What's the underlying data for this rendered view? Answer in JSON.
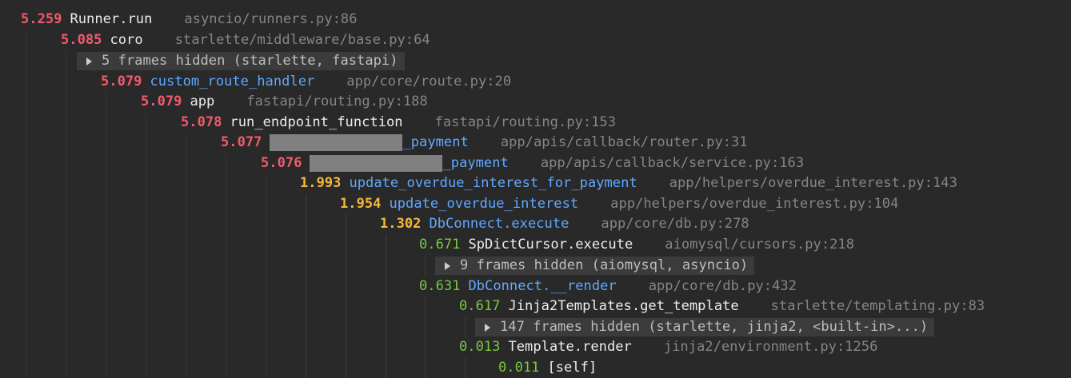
{
  "frames": [
    {
      "time": "5.259",
      "fn": "Runner.run",
      "loc": "asyncio/runners.py:86"
    },
    {
      "time": "5.085",
      "fn": "coro",
      "loc": "starlette/middleware/base.py:64"
    },
    {
      "hidden": "5 frames hidden (starlette, fastapi)"
    },
    {
      "time": "5.079",
      "fn": "custom_route_handler",
      "loc": "app/core/route.py:20"
    },
    {
      "time": "5.079",
      "fn": "app",
      "loc": "fastapi/routing.py:188"
    },
    {
      "time": "5.078",
      "fn": "run_endpoint_function",
      "loc": "fastapi/routing.py:153"
    },
    {
      "time": "5.077",
      "fn": "_payment",
      "loc": "app/apis/callback/router.py:31"
    },
    {
      "time": "5.076",
      "fn": "_payment",
      "loc": "app/apis/callback/service.py:163"
    },
    {
      "time": "1.993",
      "fn": "update_overdue_interest_for_payment",
      "loc": "app/helpers/overdue_interest.py:143"
    },
    {
      "time": "1.954",
      "fn": "update_overdue_interest",
      "loc": "app/helpers/overdue_interest.py:104"
    },
    {
      "time": "1.302",
      "fn": "DbConnect.execute",
      "loc": "app/core/db.py:278"
    },
    {
      "time": "0.671",
      "fn": "SpDictCursor.execute",
      "loc": "aiomysql/cursors.py:218"
    },
    {
      "hidden": "9 frames hidden (aiomysql, asyncio)"
    },
    {
      "time": "0.631",
      "fn": "DbConnect.__render",
      "loc": "app/core/db.py:432"
    },
    {
      "time": "0.617",
      "fn": "Jinja2Templates.get_template",
      "loc": "starlette/templating.py:83"
    },
    {
      "hidden": "147 frames hidden (starlette, jinja2, <built-in>...)"
    },
    {
      "time": "0.013",
      "fn": "Template.render",
      "loc": "jinja2/environment.py:1256"
    },
    {
      "time": "0.011",
      "fn": "[self]",
      "loc": ""
    }
  ]
}
